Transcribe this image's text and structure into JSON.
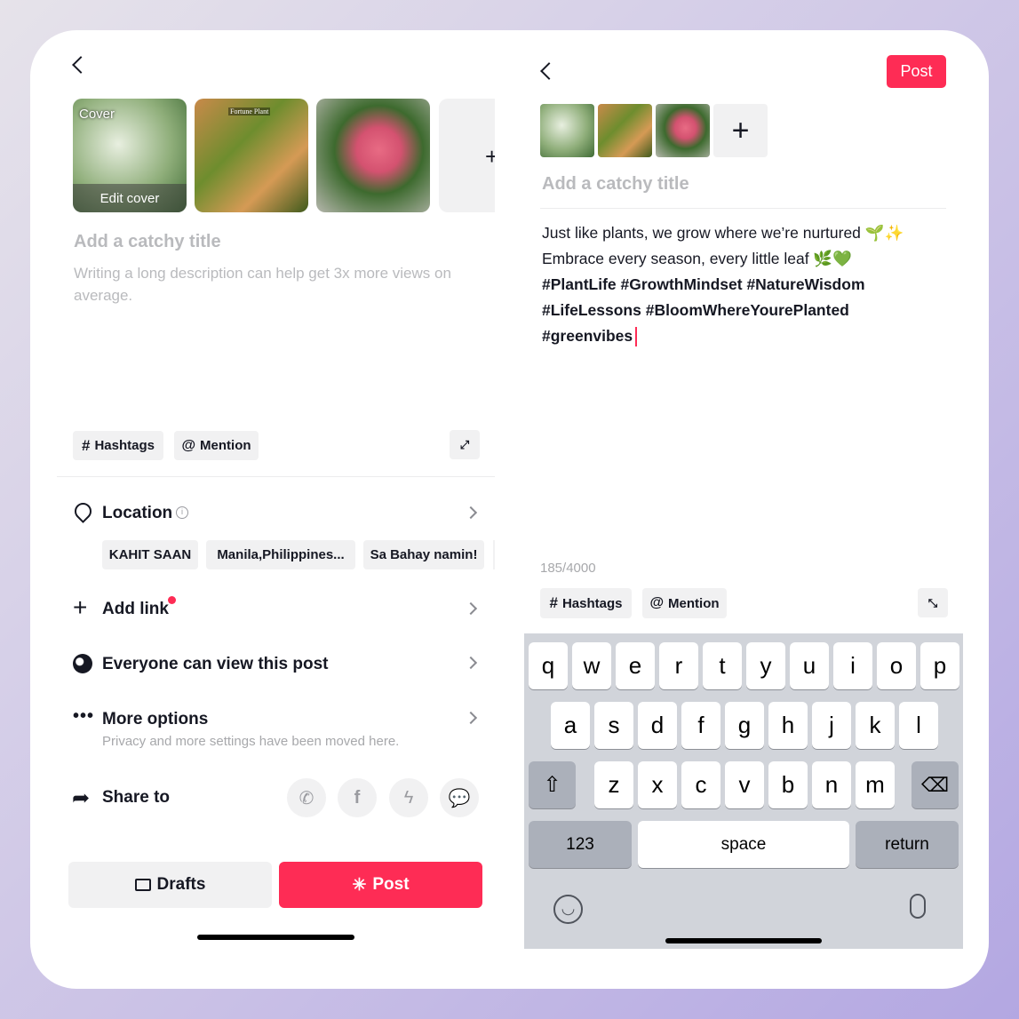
{
  "left": {
    "cover_label": "Cover",
    "edit_cover": "Edit cover",
    "thumb2_caption": "Fortune Plant",
    "title_placeholder": "Add a catchy title",
    "description_placeholder": "Writing a long description can help get 3x more views on average.",
    "hashtags": "Hashtags",
    "mention": "Mention",
    "location": "Location",
    "location_chips": [
      "KAHIT SAAN",
      "Manila,Philippines...",
      "Sa Bahay namin!"
    ],
    "add_link": "Add link",
    "visibility": "Everyone can view this post",
    "more_options": "More options",
    "more_options_sub": "Privacy and more settings have been moved here.",
    "share_to": "Share to",
    "drafts": "Drafts",
    "post": "Post"
  },
  "right": {
    "post": "Post",
    "title_placeholder": "Add a catchy title",
    "caption_lines": [
      "Just like plants, we grow where we’re nurtured 🌱✨",
      "Embrace every season, every little leaf 🌿💚",
      "#PlantLife #GrowthMindset #NatureWisdom",
      "#LifeLessons #BloomWhereYourePlanted",
      "#greenvibes"
    ],
    "char_count": "185/4000",
    "hashtags": "Hashtags",
    "mention": "Mention"
  },
  "keyboard": {
    "row1": [
      "q",
      "w",
      "e",
      "r",
      "t",
      "y",
      "u",
      "i",
      "o",
      "p"
    ],
    "row2": [
      "a",
      "s",
      "d",
      "f",
      "g",
      "h",
      "j",
      "k",
      "l"
    ],
    "row3": [
      "z",
      "x",
      "c",
      "v",
      "b",
      "n",
      "m"
    ],
    "numbers": "123",
    "space": "space",
    "return": "return"
  },
  "colors": {
    "accent": "#fe2c55",
    "keyboard_bg": "#d1d4da"
  }
}
